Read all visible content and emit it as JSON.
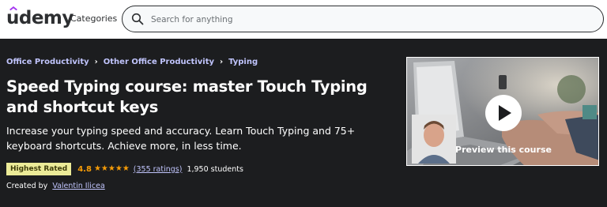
{
  "header": {
    "logo": "udemy",
    "categories_label": "Categories",
    "search_placeholder": "Search for anything"
  },
  "breadcrumb": {
    "items": [
      "Office Productivity",
      "Other Office Productivity",
      "Typing"
    ]
  },
  "course": {
    "title": "Speed Typing course: master Touch Typing and shortcut keys",
    "subtitle": "Increase your typing speed and accuracy. Learn Touch Typing and 75+ keyboard shortcuts. Achieve more, in less time.",
    "badge": "Highest Rated",
    "rating": "4.8",
    "stars": 5,
    "ratings_count": "(355 ratings)",
    "students": "1,950 students",
    "created_by_label": "Created by",
    "instructor": "Valentin Ilicea"
  },
  "preview": {
    "label": "Preview this course"
  },
  "colors": {
    "background": "#1c1d1f",
    "link": "#c0c4fc",
    "star": "#f69c08",
    "badge_bg": "#eceb98",
    "badge_text": "#3d3c0a"
  },
  "icons": {
    "search": "search-icon",
    "star": "star-icon",
    "play": "play-icon",
    "breadcrumb_separator": "chevron-right-icon"
  }
}
